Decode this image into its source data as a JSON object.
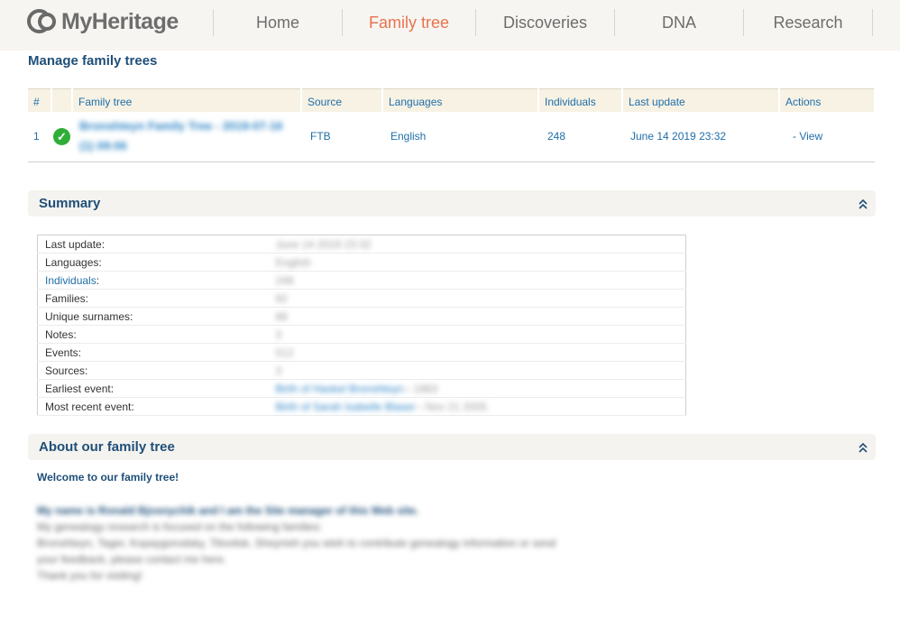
{
  "brand": {
    "name": "MyHeritage"
  },
  "nav": [
    {
      "label": "Home",
      "active": false
    },
    {
      "label": "Family tree",
      "active": true
    },
    {
      "label": "Discoveries",
      "active": false
    },
    {
      "label": "DNA",
      "active": false
    },
    {
      "label": "Research",
      "active": false
    }
  ],
  "page": {
    "title": "Manage family trees"
  },
  "trees_table": {
    "headers": [
      "#",
      "",
      "Family tree",
      "Source",
      "Languages",
      "Individuals",
      "Last update",
      "Actions"
    ],
    "rows": [
      {
        "num": "1",
        "status_icon": "check-circle-icon",
        "name": "Bronshteyn Family Tree - 2019-07-16 (1) 09:06",
        "source": "FTB",
        "language": "English",
        "individuals": "248",
        "last_update": "June 14 2019 23:32",
        "action": "- View"
      }
    ]
  },
  "summary": {
    "title": "Summary",
    "rows": [
      {
        "label": "Last update:",
        "value": "June 14 2019 23:32"
      },
      {
        "label": "Languages:",
        "value": "English"
      },
      {
        "label": "Individuals:",
        "value": "248",
        "link": "Individuals"
      },
      {
        "label": "Families:",
        "value": "92"
      },
      {
        "label": "Unique surnames:",
        "value": "88"
      },
      {
        "label": "Notes:",
        "value": "3"
      },
      {
        "label": "Events:",
        "value": "512"
      },
      {
        "label": "Sources:",
        "value": "3"
      },
      {
        "label": "Earliest event:",
        "value": "Birth of Haskel Bronshteyn",
        "extra": "1863"
      },
      {
        "label": "Most recent event:",
        "value": "Birth of Sarah Isabelle Blaser",
        "extra": "Nov 21 2005"
      }
    ]
  },
  "about": {
    "title": "About our family tree",
    "welcome": "Welcome to our family tree!",
    "lines": [
      "My name is Ronald Bjosnychik and I am the Site manager of this Web site.",
      "My genealogy research is focused on the following families:",
      "Bronshteyn, Tager, Kopaygorodsky, Titovitsk, Sheynish you wish to contribute genealogy information or send",
      "your feedback, please contact me here.",
      "Thank you for visiting!"
    ]
  },
  "colors": {
    "accent": "#e8734e",
    "heading": "#1f4f79",
    "link": "#1f6ea8",
    "header_bg": "#f7f5f1",
    "success": "#2eae36"
  }
}
